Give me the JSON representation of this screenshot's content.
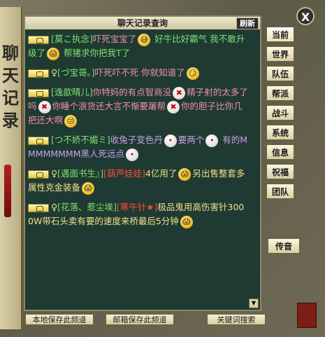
{
  "window": {
    "title": "聊天记录查询",
    "refresh_label": "刷新",
    "side_title": "聊天记录",
    "close_label": "X"
  },
  "tabs": [
    "当前",
    "世界",
    "队伍",
    "帮派",
    "战斗",
    "系统",
    "信息",
    "祝福",
    "团队"
  ],
  "voice_tab": "传音",
  "messages": [
    {
      "name": "[莫こ执念]",
      "text_a": "吓死宝宝了",
      "text_b": "好牛比好霸气 我不敢升级了",
      "text_c": "帮猪求你把我T了"
    },
    {
      "name": "[づ宝哥。]",
      "text_a": "吓死吓不死 你就知道了"
    },
    {
      "name": "[逸歆晴儿]",
      "text_a": "你特妈的有点智商没",
      "text_b": "精子射的太多了吗",
      "text_c": "你睡个浪货还大言不惭要屠帮",
      "text_d": "你的胆子比你几把还大啊"
    },
    {
      "name": "[つ不娇不媚ミ]",
      "text_a": "收兔子变色丹",
      "text_b": "要两个",
      "text_c": "有的MMMMMMMM黑人死远点"
    },
    {
      "name": "[遇面书生』]",
      "title": "[葫芦娃娃]",
      "text_a": "4亿用了",
      "text_b": "另出售整套多属性克金装备"
    },
    {
      "name": "[花落、惹尘埃]",
      "title": "[寒午针★]",
      "text_a": "极品鬼用高伤害针3000W带石头卖有要的速度来桥最后5分钟"
    }
  ],
  "buttons": {
    "save_local": "本地保存此频道",
    "save_mail": "邮箱保存此频道",
    "keyword_search": "关键词搜索"
  },
  "colors": {
    "panel_bg": "#1f3a32",
    "name_green": "#7fe26e",
    "text_pink": "#f08fa8",
    "text_yellow": "#f0e08a",
    "text_purple": "#c8a0e8",
    "title_red": "#ff4a3c"
  }
}
